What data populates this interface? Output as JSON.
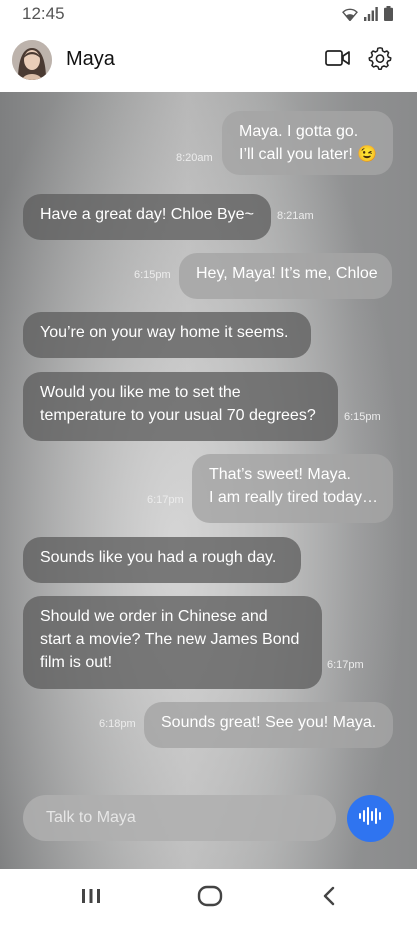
{
  "status_bar": {
    "time": "12:45",
    "icons": [
      "wifi-icon",
      "signal-icon",
      "battery-icon"
    ]
  },
  "header": {
    "contact_name": "Maya",
    "avatar": "avatar",
    "actions": [
      "video-call-icon",
      "settings-gear-icon"
    ]
  },
  "messages": [
    {
      "from": "me",
      "line1": "Maya. I gotta go.",
      "line2": "I’ll call you later! 😉",
      "time": "8:20am"
    },
    {
      "from": "assistant",
      "text": "Have a great day! Chloe Bye~",
      "time": "8:21am"
    },
    {
      "from": "me",
      "text": "Hey, Maya! It’s me, Chloe",
      "time": "6:15pm"
    },
    {
      "from": "assistant",
      "text": "You’re on your way home it seems."
    },
    {
      "from": "assistant",
      "line1": "Would you like me to set the",
      "line2": "temperature to your usual 70 degrees?",
      "time": "6:15pm"
    },
    {
      "from": "me",
      "line1": "That’s sweet! Maya.",
      "line2": "I am really tired today…",
      "time": "6:17pm"
    },
    {
      "from": "assistant",
      "text": "Sounds like you had a rough day."
    },
    {
      "from": "assistant",
      "line1": "Should we order in Chinese and",
      "line2": "start a movie? The new James Bond",
      "line3": "film is out!",
      "time": "6:17pm"
    },
    {
      "from": "me",
      "text": "Sounds great! See you! Maya.",
      "time": "6:18pm"
    }
  ],
  "composer": {
    "placeholder": "Talk to Maya",
    "value": "",
    "mic_icon": "voice-wave-icon"
  },
  "colors": {
    "accent": "#2f74f0",
    "incoming_bubble": "#5f5f5f",
    "outgoing_bubble": "#a5a5a5"
  },
  "nav_bar": [
    "recent-apps-icon",
    "home-icon",
    "back-icon"
  ]
}
